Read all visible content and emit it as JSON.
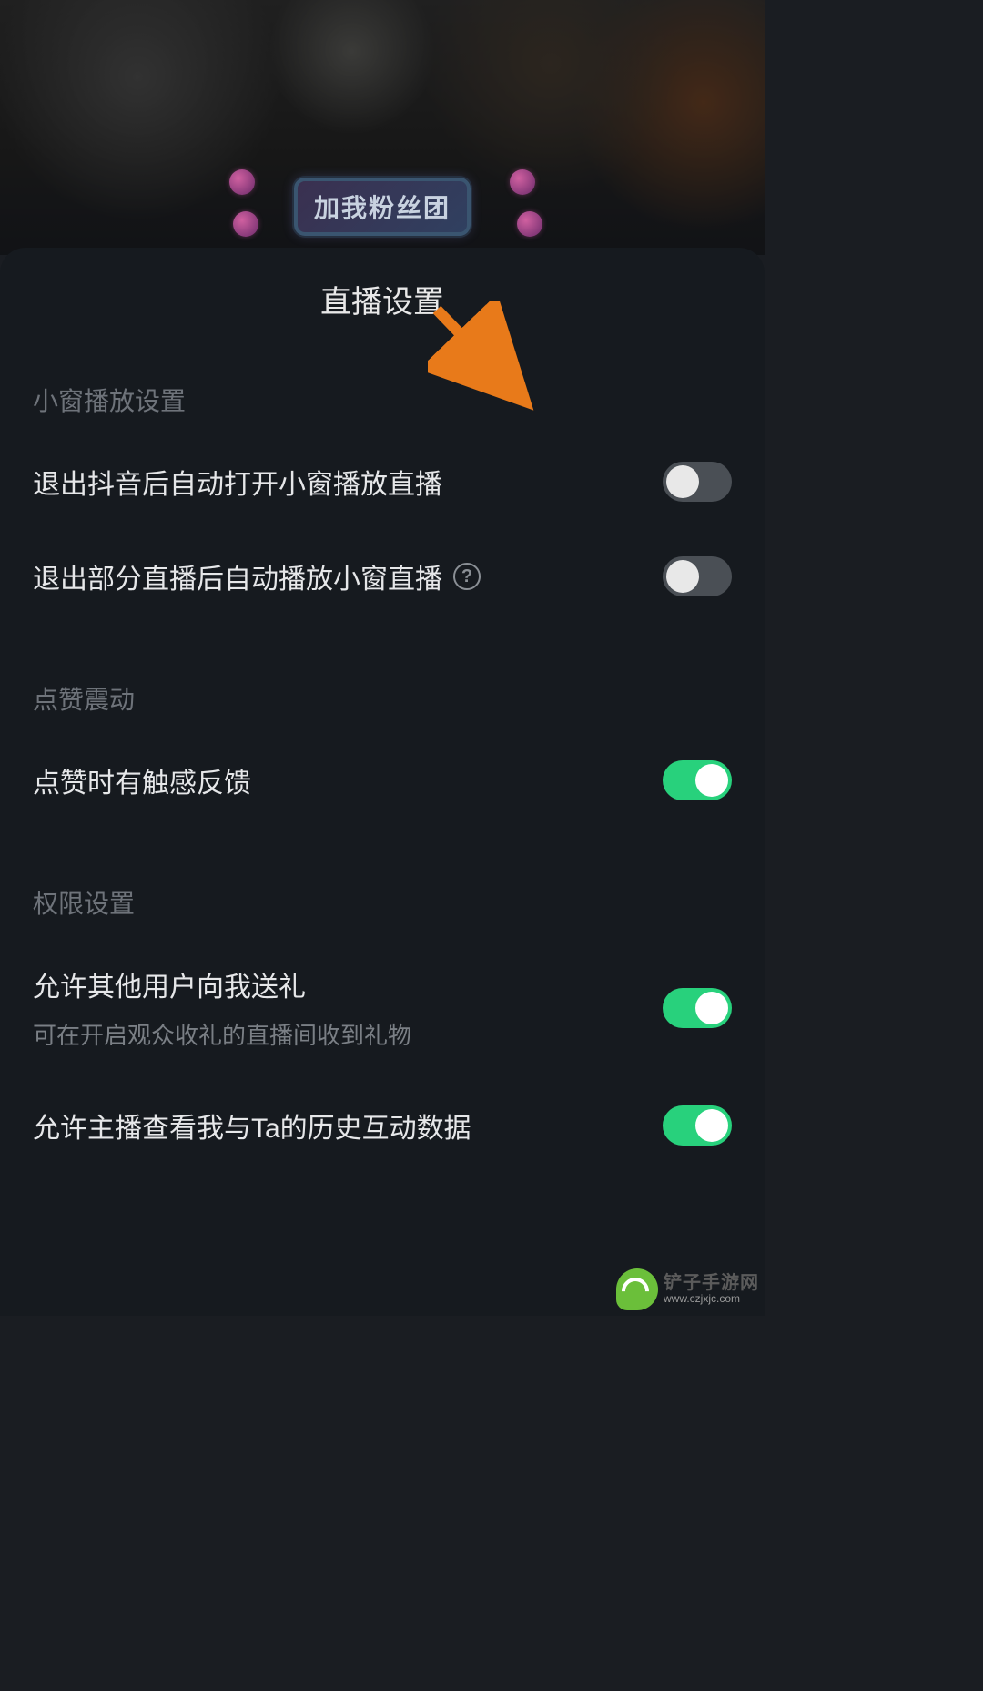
{
  "background": {
    "fan_badge": "加我粉丝团"
  },
  "panel": {
    "title": "直播设置",
    "sections": {
      "mini_window": {
        "label": "小窗播放设置",
        "items": [
          {
            "label": "退出抖音后自动打开小窗播放直播",
            "enabled": false,
            "help": false
          },
          {
            "label": "退出部分直播后自动播放小窗直播",
            "enabled": false,
            "help": true
          }
        ]
      },
      "like_vibration": {
        "label": "点赞震动",
        "items": [
          {
            "label": "点赞时有触感反馈",
            "enabled": true
          }
        ]
      },
      "permissions": {
        "label": "权限设置",
        "items": [
          {
            "label": "允许其他用户向我送礼",
            "sub": "可在开启观众收礼的直播间收到礼物",
            "enabled": true
          },
          {
            "label": "允许主播查看我与Ta的历史互动数据",
            "enabled": true
          }
        ]
      }
    }
  },
  "watermark": {
    "name": "铲子手游网",
    "url": "www.czjxjc.com"
  },
  "colors": {
    "panel_bg": "#161a1f",
    "text_primary": "#e6e7e9",
    "text_secondary": "#6e737a",
    "toggle_on": "#28d17c",
    "toggle_off": "#4a4f55",
    "arrow": "#e87a1a"
  }
}
